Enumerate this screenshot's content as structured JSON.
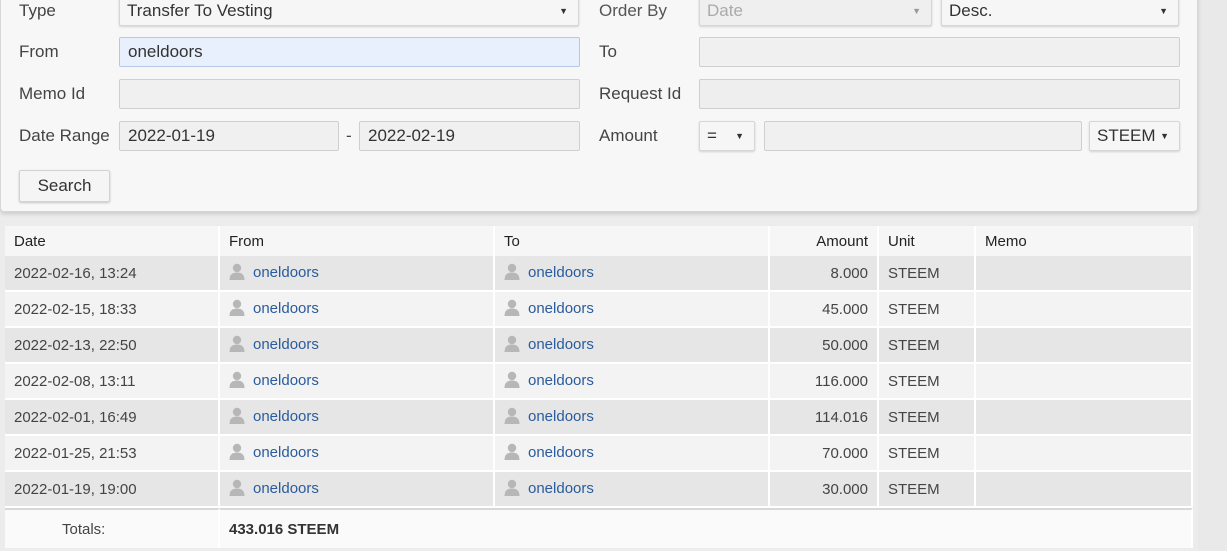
{
  "form": {
    "type_label": "Type",
    "type_value": "Transfer To Vesting",
    "order_by_label": "Order By",
    "order_by_value": "Date",
    "order_dir_value": "Desc.",
    "from_label": "From",
    "from_value": "oneldoors",
    "to_label": "To",
    "to_value": "",
    "memo_id_label": "Memo Id",
    "memo_id_value": "",
    "request_id_label": "Request Id",
    "request_id_value": "",
    "date_range_label": "Date Range",
    "date_from": "2022-01-19",
    "date_sep": "-",
    "date_to": "2022-02-19",
    "amount_label": "Amount",
    "amount_op": "=",
    "amount_value": "",
    "amount_unit": "STEEM",
    "search_label": "Search"
  },
  "table": {
    "headers": {
      "date": "Date",
      "from": "From",
      "to": "To",
      "amount": "Amount",
      "unit": "Unit",
      "memo": "Memo"
    },
    "rows": [
      {
        "date": "2022-02-16, 13:24",
        "from": "oneldoors",
        "to": "oneldoors",
        "amount": "8.000",
        "unit": "STEEM",
        "memo": ""
      },
      {
        "date": "2022-02-15, 18:33",
        "from": "oneldoors",
        "to": "oneldoors",
        "amount": "45.000",
        "unit": "STEEM",
        "memo": ""
      },
      {
        "date": "2022-02-13, 22:50",
        "from": "oneldoors",
        "to": "oneldoors",
        "amount": "50.000",
        "unit": "STEEM",
        "memo": ""
      },
      {
        "date": "2022-02-08, 13:11",
        "from": "oneldoors",
        "to": "oneldoors",
        "amount": "116.000",
        "unit": "STEEM",
        "memo": ""
      },
      {
        "date": "2022-02-01, 16:49",
        "from": "oneldoors",
        "to": "oneldoors",
        "amount": "114.016",
        "unit": "STEEM",
        "memo": ""
      },
      {
        "date": "2022-01-25, 21:53",
        "from": "oneldoors",
        "to": "oneldoors",
        "amount": "70.000",
        "unit": "STEEM",
        "memo": ""
      },
      {
        "date": "2022-01-19, 19:00",
        "from": "oneldoors",
        "to": "oneldoors",
        "amount": "30.000",
        "unit": "STEEM",
        "memo": ""
      }
    ],
    "totals_label": "Totals:",
    "totals_value": "433.016 STEEM"
  },
  "icons": {
    "user": "person-icon",
    "dropdown": "caret-down-icon"
  },
  "colors": {
    "link": "#2a5b9e",
    "row_odd": "#e6e6e6",
    "row_even": "#f3f3f3",
    "active_input": "#e8f0fd"
  }
}
